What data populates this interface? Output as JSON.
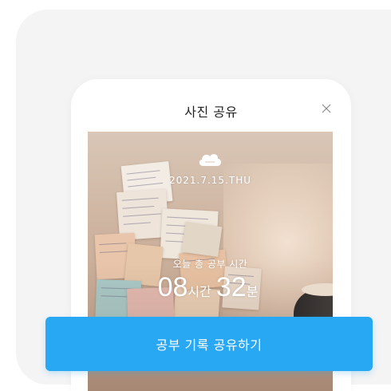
{
  "modal": {
    "title": "사진 공유",
    "close_icon": "close-icon"
  },
  "photo_card": {
    "logo_icon": "cloud-logo-icon",
    "date": "2021.7.15.THU",
    "today_label": "오늘 총 공부 시간",
    "hours_value": "08",
    "hours_unit": "시간",
    "minutes_value": "32",
    "minutes_unit": "분"
  },
  "actions": {
    "share_label": "공부 기록 공유하기"
  },
  "colors": {
    "accent": "#28a8f2",
    "background_card": "#f4f4f5",
    "title_text": "#222222"
  }
}
